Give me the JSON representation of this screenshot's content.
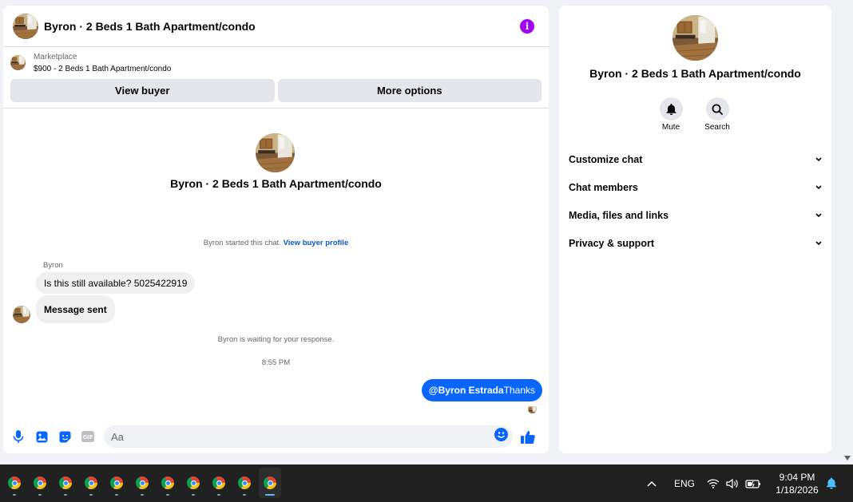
{
  "chat": {
    "title": "Byron · 2 Beds 1 Bath Apartment/condo",
    "marketplace_label": "Marketplace",
    "listing_line": "$900 - 2 Beds 1 Bath Apartment/condo",
    "view_buyer_label": "View buyer",
    "more_options_label": "More options",
    "center_title": "Byron · 2 Beds 1 Bath Apartment/condo",
    "started_text": "Byron started this chat.",
    "view_profile_link": "View buyer profile",
    "sender_name": "Byron",
    "message_1": "Is this still available? 5025422919",
    "message_2": "Message sent",
    "waiting_text": "Byron is waiting for your response.",
    "timestamp": "8:55 PM",
    "outgoing_mention": "@Byron Estrada",
    "outgoing_text": "Thanks",
    "composer_placeholder": "Aa"
  },
  "info_panel": {
    "title": "Byron · 2 Beds 1 Bath Apartment/condo",
    "mute_label": "Mute",
    "search_label": "Search",
    "sections": [
      "Customize chat",
      "Chat members",
      "Media, files and links",
      "Privacy & support"
    ]
  },
  "taskbar": {
    "app_icons": [
      "chrome-icon",
      "chrome-icon",
      "chrome-icon",
      "chrome-icon",
      "chrome-icon",
      "chrome-icon",
      "chrome-icon",
      "chrome-icon",
      "chrome-icon",
      "chrome-icon",
      "chrome-icon"
    ],
    "language": "ENG",
    "time": "9:04 PM",
    "date": "1/18/2026"
  },
  "colors": {
    "accent": "#0866ff",
    "info_icon": "#a400f5",
    "bubble_in": "#f0f0f0",
    "taskbar": "#202020"
  }
}
